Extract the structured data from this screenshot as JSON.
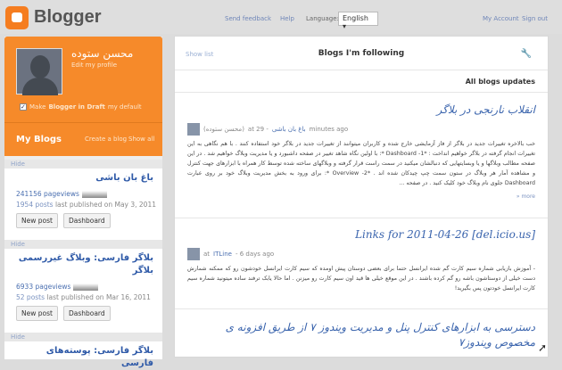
{
  "header": {
    "brand": "Blogger",
    "links": {
      "feedback": "Send feedback",
      "help": "Help",
      "language_label": "Language:",
      "language_value": "English",
      "my_account": "My Account",
      "sign_out": "Sign out"
    }
  },
  "profile": {
    "name": "محسن ستوده",
    "edit": "Edit my profile",
    "draft_prefix": "Make",
    "draft_bold": "Blogger in Draft",
    "draft_suffix": "my default",
    "draft_checked": true
  },
  "my_blogs": {
    "title": "My Blogs",
    "create": "Create a blog",
    "show_all": "Show all",
    "hide": "Hide",
    "new_post": "New post",
    "dashboard": "Dashboard",
    "blogs": [
      {
        "title": "باغ بان باشی",
        "pageviews": "241156 pageviews",
        "posts": "1954 posts",
        "last": "last published on May 3, 2011"
      },
      {
        "title": "بلاگر فارسی: وبلاگ غیررسمی بلاگر",
        "pageviews": "6933 pageviews",
        "posts": "52 posts",
        "last": "last published on Mar 16, 2011"
      },
      {
        "title": "بلاگر فارسی: پوسته‌های فارسی"
      }
    ]
  },
  "main": {
    "show_list": "Show list",
    "title": "Blogs I'm following",
    "all_updates": "All blogs updates",
    "more": "» more",
    "posts": [
      {
        "title": "انقلاب نارنجی در بلاگر",
        "author": "(محسن ستوده)",
        "at": "at 29 -",
        "blog": "باغ بان باشی",
        "time": "minutes ago",
        "body": "خب بالاخره تغییرات جدید در بلاگر از فاز آزمایشی خارج شده و کاربران میتوانند از تغییرات جدید در بلاگر خود استفاده کنند . با هم نگاهی به این تغییرات انجام گرفته در بلاگر خواهیم انداخت : *1- Dashboard *: با اولین نگاه شاهد تغییر در صفحه داشبورد و یا مدیریت وبلاگ خواهیم شد . در این صفحه مطالب وبلاگها و یا وبسایتهایی که دنبالشان میکنید در سمت راست قرار گرفته و وبلاگهای ساخته شده توسط کار همراه با ابزارهای جهت کنترل و مشاهده آمار هر وبلاگ در ستون سمت چپ چیدکان شده اند . *2- Overview *: برای ورود به بخش مدیریت وبلاگ خود بر روی عبارت Dashboard جلوی نام وبلاگ خود کلیک کنید . در صفحه ..."
      },
      {
        "title": "[Links for 2011-04-26 [del.icio.us",
        "at": "at",
        "blog": "ITLine",
        "time": "- 6 days ago",
        "body": "- آموزش بازیابی شماره سیم کارت گم شده ایرانسل حتما برای بعضی دوستان پیش اومده که سیم کارت ایرانسل خودشون رو که ممکنه شمارش دست خیلی از دوستاشون باشه رو گم کرده باشند . در این موقع خیلی ها قید اون سیم کارت رو میزنن . اما حالا یابک ترفند ساده میتونید شماره سیم کارت ایرانسل خودتون پس بگیرید!"
      },
      {
        "title": "دسترسی به ابزارهای کنترل پنل و مدیریت ویندوز ۷ از طریق افزونه ی مخصوص ویندوز۷"
      }
    ]
  }
}
